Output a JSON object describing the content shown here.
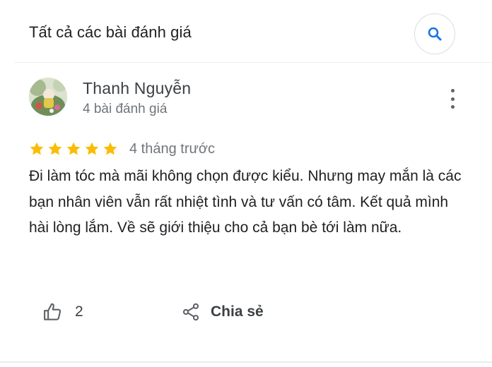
{
  "header": {
    "title": "Tất cả các bài đánh giá",
    "search_icon": "search-icon"
  },
  "review": {
    "author": "Thanh Nguyễn",
    "author_meta": "4 bài đánh giá",
    "rating": 5,
    "rating_max": 5,
    "time": "4 tháng trước",
    "text": "Đi làm tóc mà mãi không chọn được kiểu. Nhưng may mắn là các bạn nhân viên vẫn rất nhiệt tình và tư vấn có tâm. Kết quả mình hài lòng lắm. Về sẽ giới thiệu cho cả bạn bè tới làm nữa.",
    "more_icon": "more-vert-icon"
  },
  "actions": {
    "like_icon": "thumb-up-icon",
    "like_count": "2",
    "share_icon": "share-icon",
    "share_label": "Chia sẻ"
  },
  "colors": {
    "star": "#fbbc04",
    "accent": "#1a73e8",
    "text": "#202124",
    "secondary": "#70757a"
  }
}
